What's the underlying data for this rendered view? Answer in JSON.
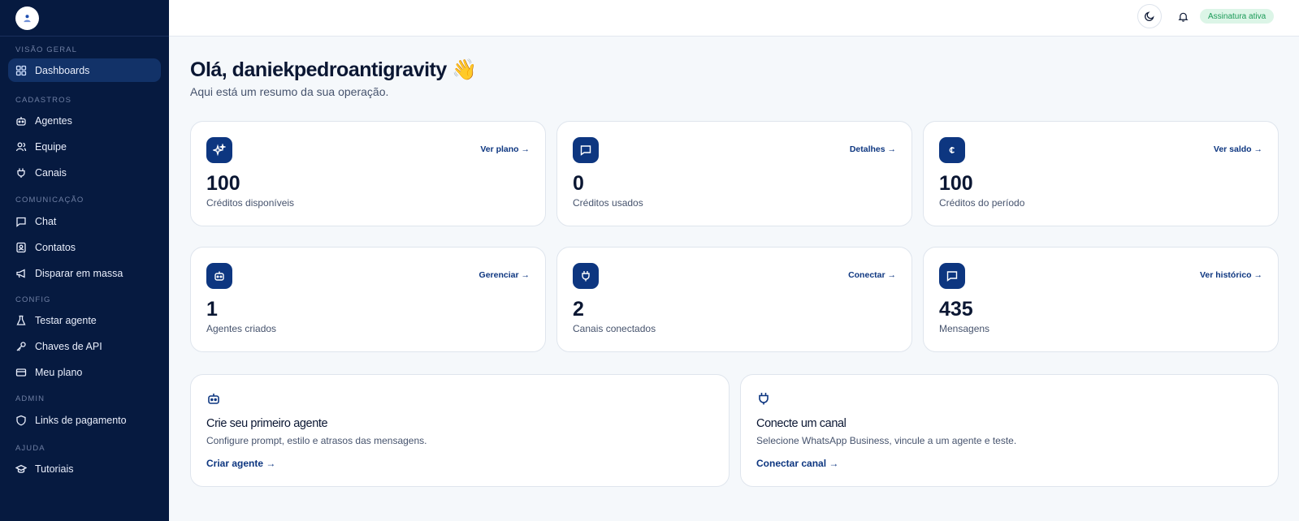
{
  "topbar": {
    "status_badge": "Assinatura ativa",
    "theme_icon": "moon-icon",
    "notifications_icon": "bell-icon"
  },
  "sidebar": {
    "sections": [
      {
        "label": "VISÃO GERAL",
        "items": [
          {
            "label": "Dashboards",
            "icon": "grid-icon",
            "active": true
          }
        ]
      },
      {
        "label": "CADASTROS",
        "items": [
          {
            "label": "Agentes",
            "icon": "bot-icon"
          },
          {
            "label": "Equipe",
            "icon": "users-icon"
          },
          {
            "label": "Canais",
            "icon": "plug-icon"
          }
        ]
      },
      {
        "label": "COMUNICAÇÃO",
        "items": [
          {
            "label": "Chat",
            "icon": "chat-icon"
          },
          {
            "label": "Contatos",
            "icon": "contacts-icon"
          },
          {
            "label": "Disparar em massa",
            "icon": "megaphone-icon"
          }
        ]
      },
      {
        "label": "CONFIG",
        "items": [
          {
            "label": "Testar agente",
            "icon": "flask-icon"
          },
          {
            "label": "Chaves de API",
            "icon": "key-icon"
          },
          {
            "label": "Meu plano",
            "icon": "card-icon"
          }
        ]
      },
      {
        "label": "ADMIN",
        "items": [
          {
            "label": "Links de pagamento",
            "icon": "shield-icon"
          }
        ]
      },
      {
        "label": "AJUDA",
        "items": [
          {
            "label": "Tutoriais",
            "icon": "graduation-icon"
          }
        ]
      }
    ]
  },
  "main": {
    "greeting": "Olá, daniekpedroantigravity 👋",
    "subtitle": "Aqui está um resumo da sua operação.",
    "stats": [
      {
        "value": "100",
        "label": "Créditos disponíveis",
        "link": "Ver plano →",
        "icon": "sparkles-icon"
      },
      {
        "value": "0",
        "label": "Créditos usados",
        "link": "Detalhes →",
        "icon": "chat-icon"
      },
      {
        "value": "100",
        "label": "Créditos do período",
        "link": "Ver saldo →",
        "icon": "coin-icon"
      },
      {
        "value": "1",
        "label": "Agentes criados",
        "link": "Gerenciar →",
        "icon": "bot-icon"
      },
      {
        "value": "2",
        "label": "Canais conectados",
        "link": "Conectar →",
        "icon": "plug-icon"
      },
      {
        "value": "435",
        "label": "Mensagens",
        "link": "Ver histórico →",
        "icon": "chat-icon"
      }
    ],
    "ctas": [
      {
        "title": "Crie seu primeiro agente",
        "desc": "Configure prompt, estilo e atrasos das mensagens.",
        "link": "Criar agente →",
        "icon": "bot-icon"
      },
      {
        "title": "Conecte um canal",
        "desc": "Selecione WhatsApp Business, vincule a um agente e teste.",
        "link": "Conectar canal →",
        "icon": "plug-icon"
      }
    ]
  },
  "colors": {
    "sidebar": "#061a40",
    "accent": "#0d3680",
    "success": "#1b9a58"
  }
}
